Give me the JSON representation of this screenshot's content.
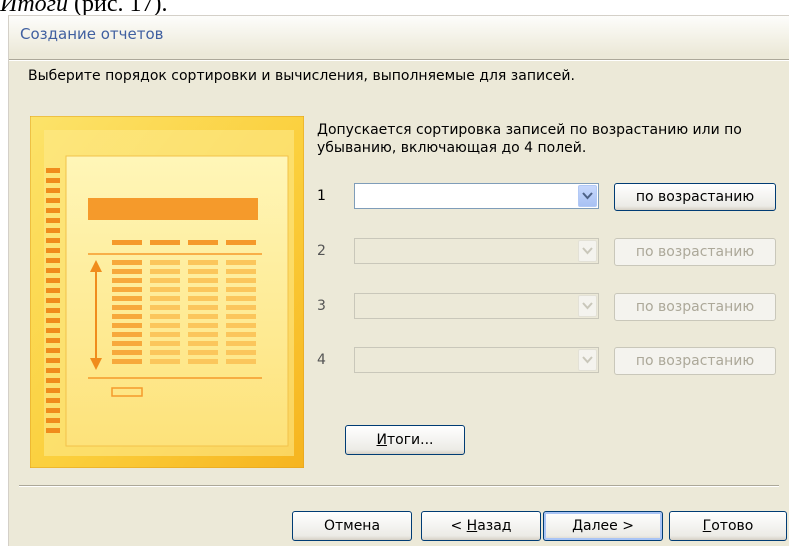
{
  "document": {
    "italic_word": "Итоги",
    "trailing_text": " (рис. 17)."
  },
  "dialog": {
    "title": "Создание отчетов",
    "instruction": "Выберите порядок сортировки и вычисления, выполняемые для записей.",
    "hint": "Допускается сортировка записей по возрастанию или по убыванию, включающая до 4 полей.",
    "sort_rows": [
      {
        "number": "1",
        "field_value": "",
        "order_label": "по возрастанию",
        "enabled": true
      },
      {
        "number": "2",
        "field_value": "",
        "order_label": "по возрастанию",
        "enabled": false
      },
      {
        "number": "3",
        "field_value": "",
        "order_label": "по возрастанию",
        "enabled": false
      },
      {
        "number": "4",
        "field_value": "",
        "order_label": "по возрастанию",
        "enabled": false
      }
    ],
    "totals_button": {
      "accel": "И",
      "rest": "тоги..."
    },
    "buttons": {
      "cancel": "Отмена",
      "back_prefix": "< ",
      "back_accel": "Н",
      "back_rest": "азад",
      "next_accel": "Д",
      "next_rest": "алее >",
      "finish_accel": "Г",
      "finish_rest": "отово"
    }
  },
  "colors": {
    "title_text": "#3f5fa0",
    "dialog_background": "#ece9d8",
    "illustration_orange": "#f59a2b",
    "illustration_yellow": "#fdd84a"
  },
  "icons": {
    "dropdown": "chevron-down-icon",
    "illustration": "report-sorting-illustration"
  }
}
